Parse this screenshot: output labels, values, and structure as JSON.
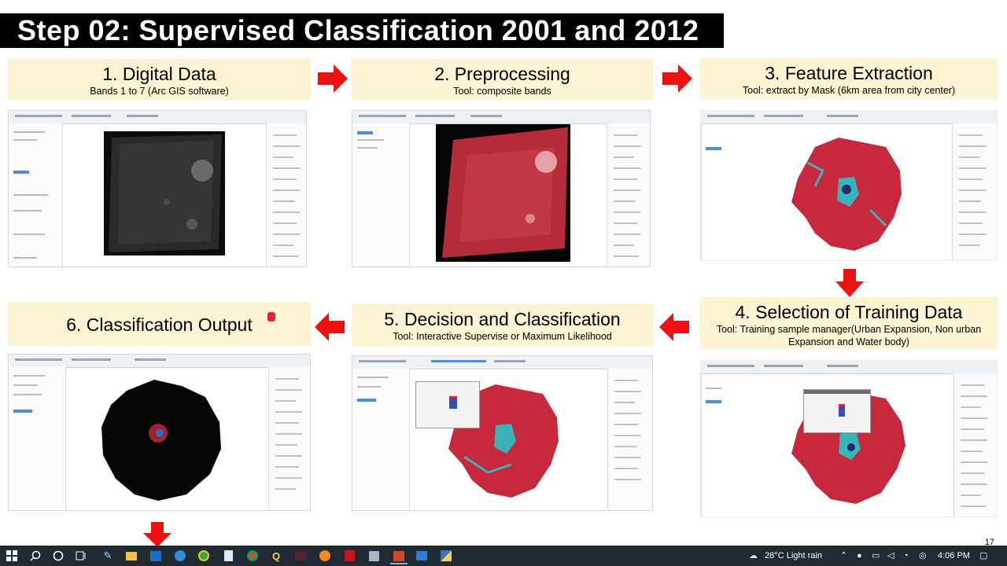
{
  "slide": {
    "title": "Step 02: Supervised Classification 2001 and 2012",
    "page_number": "17"
  },
  "steps": [
    {
      "heading": "1. Digital Data",
      "subtitle": "Bands 1 to 7 (Arc GIS software)"
    },
    {
      "heading": "2. Preprocessing",
      "subtitle": "Tool: composite bands"
    },
    {
      "heading": "3. Feature Extraction",
      "subtitle": "Tool: extract by Mask (6km area from city center)"
    },
    {
      "heading": "4. Selection of Training Data",
      "subtitle": "Tool: Training sample manager(Urban Expansion, Non urban Expansion and Water body)"
    },
    {
      "heading": "5. Decision and Classification",
      "subtitle": "Tool: Interactive Supervise or Maximum Likelihood"
    },
    {
      "heading": "6. Classification Output",
      "subtitle": ""
    }
  ],
  "colors": {
    "arrow": "#ee1111",
    "header_bg": "#fcf3d2",
    "title_bg": "#000000",
    "taskbar_bg": "#1f2a33",
    "false_color_red": "#c8283c",
    "water_cyan": "#39b3b8"
  },
  "taskbar": {
    "icons": [
      "windows-start-icon",
      "search-icon",
      "cortana-icon",
      "task-view-icon",
      "pen-icon",
      "file-explorer-icon",
      "outlook-icon",
      "edge-icon",
      "chrome-icon",
      "notes-icon",
      "chrome-alt-icon",
      "q-app-icon",
      "media-icon",
      "globe-icon",
      "pdf-icon",
      "app-icon",
      "powerpoint-icon",
      "photos-icon",
      "python-icon"
    ],
    "weather": "28°C  Light rain",
    "time": "4:06 PM"
  }
}
